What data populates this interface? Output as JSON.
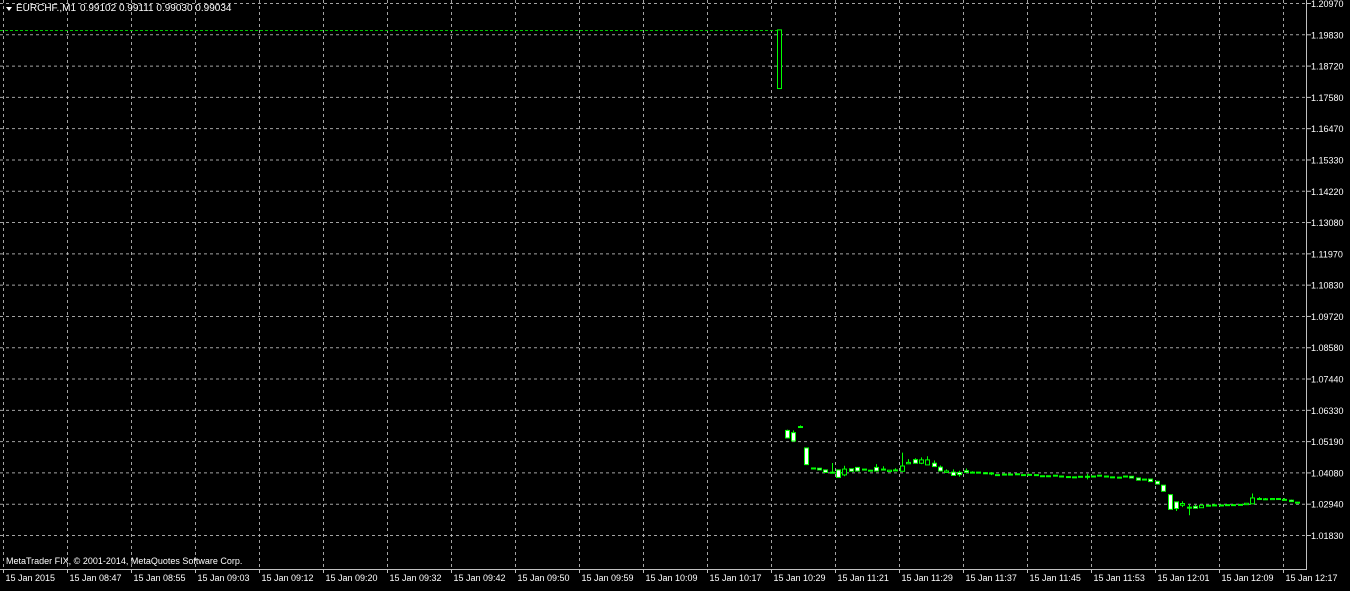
{
  "header": {
    "symbol": "EURCHF.,M1",
    "ohlc": "0.99102 0.99111 0.99030 0.99034"
  },
  "footer": {
    "copyright": "MetaTrader FIX, © 2001-2014, MetaQuotes Software Corp."
  },
  "colors": {
    "background": "#000000",
    "grid": "#c0c0c0",
    "axis_text": "#ffffff",
    "bull": "#00ff00",
    "bear": "#00ff00",
    "bull_body": "#000000",
    "bear_body": "#ffffff",
    "price_line": "#00c800"
  },
  "chart_data": {
    "type": "candlestick",
    "title": "EURCHF.,M1",
    "grid": true,
    "y_ticks": [
      "1.20970",
      "1.19830",
      "1.18720",
      "1.17580",
      "1.16470",
      "1.15330",
      "1.14220",
      "1.13080",
      "1.11970",
      "1.10830",
      "1.09720",
      "1.08580",
      "1.07440",
      "1.06330",
      "1.05190",
      "1.04080",
      "1.02940",
      "1.01830"
    ],
    "ylim": [
      1.0183,
      1.2097
    ],
    "x_ticks": [
      "15 Jan 2015",
      "15 Jan 08:47",
      "15 Jan 08:55",
      "15 Jan 09:03",
      "15 Jan 09:12",
      "15 Jan 09:20",
      "15 Jan 09:32",
      "15 Jan 09:42",
      "15 Jan 09:50",
      "15 Jan 09:59",
      "15 Jan 10:09",
      "15 Jan 10:17",
      "15 Jan 10:29",
      "15 Jan 11:21",
      "15 Jan 11:29",
      "15 Jan 11:37",
      "15 Jan 11:45",
      "15 Jan 11:53",
      "15 Jan 12:01",
      "15 Jan 12:09",
      "15 Jan 12:17"
    ],
    "price_line": 1.2002,
    "candles": [
      {
        "o": 1.1791,
        "h": 1.2002,
        "l": 1.1791,
        "c": 1.2002
      },
      {
        "o": 1.0561,
        "h": 1.0564,
        "l": 1.0534,
        "c": 1.0534
      },
      {
        "o": 1.0553,
        "h": 1.0561,
        "l": 1.0523,
        "c": 1.0523
      },
      {
        "o": 1.0575,
        "h": 1.0579,
        "l": 1.0571,
        "c": 1.0575
      },
      {
        "o": 1.0498,
        "h": 1.0498,
        "l": 1.0438,
        "c": 1.0438
      },
      {
        "o": 1.0426,
        "h": 1.0426,
        "l": 1.0423,
        "c": 1.0423
      },
      {
        "o": 1.0425,
        "h": 1.0425,
        "l": 1.0419,
        "c": 1.0419
      },
      {
        "o": 1.0419,
        "h": 1.0419,
        "l": 1.041,
        "c": 1.041
      },
      {
        "o": 1.0411,
        "h": 1.0444,
        "l": 1.0407,
        "c": 1.0407
      },
      {
        "o": 1.0419,
        "h": 1.0419,
        "l": 1.0392,
        "c": 1.0392
      },
      {
        "o": 1.0401,
        "h": 1.0434,
        "l": 1.0396,
        "c": 1.0422
      },
      {
        "o": 1.0423,
        "h": 1.0423,
        "l": 1.0414,
        "c": 1.0414
      },
      {
        "o": 1.0428,
        "h": 1.0428,
        "l": 1.0415,
        "c": 1.0415
      },
      {
        "o": 1.0419,
        "h": 1.0422,
        "l": 1.0419,
        "c": 1.0422
      },
      {
        "o": 1.0418,
        "h": 1.0419,
        "l": 1.0417,
        "c": 1.0417
      },
      {
        "o": 1.0428,
        "h": 1.044,
        "l": 1.0415,
        "c": 1.0415
      },
      {
        "o": 1.0422,
        "h": 1.0432,
        "l": 1.0422,
        "c": 1.0422
      },
      {
        "o": 1.0413,
        "h": 1.0418,
        "l": 1.0413,
        "c": 1.0418
      },
      {
        "o": 1.0419,
        "h": 1.0425,
        "l": 1.0416,
        "c": 1.0416
      },
      {
        "o": 1.0414,
        "h": 1.0481,
        "l": 1.0414,
        "c": 1.0433
      },
      {
        "o": 1.0441,
        "h": 1.0458,
        "l": 1.0441,
        "c": 1.0446
      },
      {
        "o": 1.0456,
        "h": 1.0461,
        "l": 1.0443,
        "c": 1.0443
      },
      {
        "o": 1.0443,
        "h": 1.0464,
        "l": 1.044,
        "c": 1.0455
      },
      {
        "o": 1.0437,
        "h": 1.0468,
        "l": 1.0437,
        "c": 1.0455
      },
      {
        "o": 1.0443,
        "h": 1.0453,
        "l": 1.0431,
        "c": 1.0431
      },
      {
        "o": 1.0429,
        "h": 1.0435,
        "l": 1.0415,
        "c": 1.0415
      },
      {
        "o": 1.041,
        "h": 1.0421,
        "l": 1.041,
        "c": 1.0415
      },
      {
        "o": 1.0411,
        "h": 1.0421,
        "l": 1.0399,
        "c": 1.0399
      },
      {
        "o": 1.041,
        "h": 1.0416,
        "l": 1.0395,
        "c": 1.0402
      },
      {
        "o": 1.0416,
        "h": 1.0424,
        "l": 1.041,
        "c": 1.041
      },
      {
        "o": 1.0411,
        "h": 1.0414,
        "l": 1.0408,
        "c": 1.0408
      },
      {
        "o": 1.0409,
        "h": 1.0411,
        "l": 1.0409,
        "c": 1.0411
      },
      {
        "o": 1.0409,
        "h": 1.0411,
        "l": 1.0405,
        "c": 1.0405
      },
      {
        "o": 1.0405,
        "h": 1.0411,
        "l": 1.04,
        "c": 1.0408
      },
      {
        "o": 1.0402,
        "h": 1.0402,
        "l": 1.0402,
        "c": 1.0402
      },
      {
        "o": 1.0404,
        "h": 1.0405,
        "l": 1.0403,
        "c": 1.0404
      },
      {
        "o": 1.0404,
        "h": 1.0405,
        "l": 1.0401,
        "c": 1.0401
      },
      {
        "o": 1.0402,
        "h": 1.0405,
        "l": 1.0402,
        "c": 1.0405
      },
      {
        "o": 1.0402,
        "h": 1.0402,
        "l": 1.04,
        "c": 1.04
      },
      {
        "o": 1.0403,
        "h": 1.0403,
        "l": 1.0401,
        "c": 1.0401
      },
      {
        "o": 1.0401,
        "h": 1.0402,
        "l": 1.0398,
        "c": 1.0402
      },
      {
        "o": 1.0398,
        "h": 1.0398,
        "l": 1.0397,
        "c": 1.0397
      },
      {
        "o": 1.0398,
        "h": 1.0399,
        "l": 1.0397,
        "c": 1.0397
      },
      {
        "o": 1.0399,
        "h": 1.04,
        "l": 1.0397,
        "c": 1.04
      },
      {
        "o": 1.0397,
        "h": 1.0397,
        "l": 1.0395,
        "c": 1.0395
      },
      {
        "o": 1.0395,
        "h": 1.0395,
        "l": 1.0394,
        "c": 1.0394
      },
      {
        "o": 1.0394,
        "h": 1.0394,
        "l": 1.0393,
        "c": 1.0393
      },
      {
        "o": 1.0395,
        "h": 1.0396,
        "l": 1.0394,
        "c": 1.0396
      },
      {
        "o": 1.0396,
        "h": 1.0405,
        "l": 1.0385,
        "c": 1.0396
      },
      {
        "o": 1.0397,
        "h": 1.0399,
        "l": 1.0396,
        "c": 1.0396
      },
      {
        "o": 1.0398,
        "h": 1.04,
        "l": 1.0398,
        "c": 1.04
      },
      {
        "o": 1.0397,
        "h": 1.0397,
        "l": 1.0395,
        "c": 1.0395
      },
      {
        "o": 1.0394,
        "h": 1.0394,
        "l": 1.0393,
        "c": 1.0393
      },
      {
        "o": 1.0393,
        "h": 1.0393,
        "l": 1.0392,
        "c": 1.0392
      },
      {
        "o": 1.0395,
        "h": 1.0397,
        "l": 1.0395,
        "c": 1.0397
      },
      {
        "o": 1.0396,
        "h": 1.0396,
        "l": 1.039,
        "c": 1.039
      },
      {
        "o": 1.039,
        "h": 1.0391,
        "l": 1.0382,
        "c": 1.0382
      },
      {
        "o": 1.0384,
        "h": 1.0386,
        "l": 1.0384,
        "c": 1.0386
      },
      {
        "o": 1.0386,
        "h": 1.0386,
        "l": 1.0377,
        "c": 1.0377
      },
      {
        "o": 1.0378,
        "h": 1.0378,
        "l": 1.0368,
        "c": 1.0368
      },
      {
        "o": 1.0364,
        "h": 1.0364,
        "l": 1.0342,
        "c": 1.0342
      },
      {
        "o": 1.033,
        "h": 1.033,
        "l": 1.0277,
        "c": 1.0277
      },
      {
        "o": 1.0304,
        "h": 1.0304,
        "l": 1.0271,
        "c": 1.028
      },
      {
        "o": 1.0292,
        "h": 1.0306,
        "l": 1.0285,
        "c": 1.0298
      },
      {
        "o": 1.0285,
        "h": 1.0297,
        "l": 1.0256,
        "c": 1.0285
      },
      {
        "o": 1.0288,
        "h": 1.0293,
        "l": 1.0281,
        "c": 1.0281
      },
      {
        "o": 1.0283,
        "h": 1.0296,
        "l": 1.0283,
        "c": 1.0292
      },
      {
        "o": 1.029,
        "h": 1.0292,
        "l": 1.0289,
        "c": 1.0292
      },
      {
        "o": 1.0293,
        "h": 1.0297,
        "l": 1.0291,
        "c": 1.0291
      },
      {
        "o": 1.0292,
        "h": 1.0293,
        "l": 1.029,
        "c": 1.0293
      },
      {
        "o": 1.0291,
        "h": 1.0294,
        "l": 1.029,
        "c": 1.0294
      },
      {
        "o": 1.0292,
        "h": 1.0294,
        "l": 1.0292,
        "c": 1.0294
      },
      {
        "o": 1.0293,
        "h": 1.0295,
        "l": 1.0292,
        "c": 1.0295
      },
      {
        "o": 1.0294,
        "h": 1.0299,
        "l": 1.0294,
        "c": 1.0299
      },
      {
        "o": 1.0297,
        "h": 1.0334,
        "l": 1.0297,
        "c": 1.0318
      },
      {
        "o": 1.0316,
        "h": 1.0321,
        "l": 1.0313,
        "c": 1.0313
      },
      {
        "o": 1.0315,
        "h": 1.0318,
        "l": 1.0313,
        "c": 1.0313
      },
      {
        "o": 1.0312,
        "h": 1.0318,
        "l": 1.0312,
        "c": 1.0316
      },
      {
        "o": 1.0313,
        "h": 1.0317,
        "l": 1.0313,
        "c": 1.0316
      },
      {
        "o": 1.0313,
        "h": 1.0318,
        "l": 1.0311,
        "c": 1.0311
      },
      {
        "o": 1.031,
        "h": 1.0312,
        "l": 1.0305,
        "c": 1.0305
      },
      {
        "o": 1.0303,
        "h": 1.0304,
        "l": 1.03,
        "c": 1.03
      }
    ]
  }
}
